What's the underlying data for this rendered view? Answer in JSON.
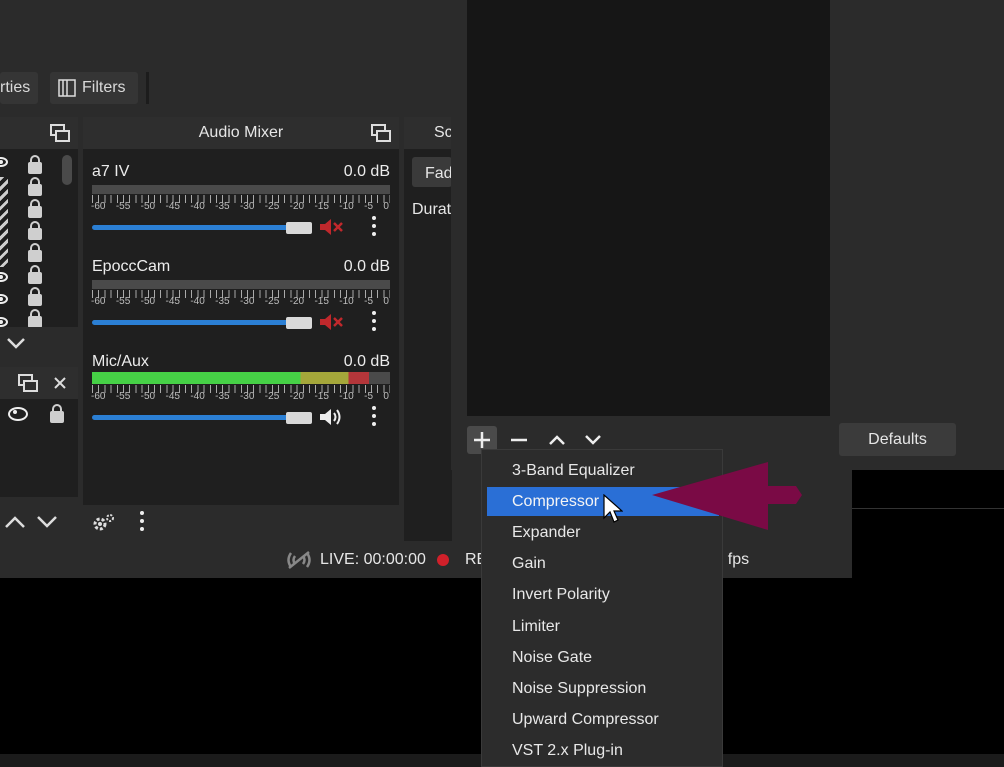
{
  "toolbar": {
    "properties_label": "rties",
    "filters_label": "Filters"
  },
  "mixer": {
    "title": "Audio Mixer",
    "tick_labels": [
      "-60",
      "-55",
      "-50",
      "-45",
      "-40",
      "-35",
      "-30",
      "-25",
      "-20",
      "-15",
      "-10",
      "-5",
      "0"
    ],
    "channels": [
      {
        "name": "a7 IV",
        "db": "0.0 dB",
        "muted": true,
        "level": 0
      },
      {
        "name": "EpoccCam",
        "db": "0.0 dB",
        "muted": true,
        "level": 0
      },
      {
        "name": "Mic/Aux",
        "db": "0.0 dB",
        "muted": false,
        "level": 0.93
      }
    ]
  },
  "transitions": {
    "title_partial": "Sc",
    "fade_partial": "Fad",
    "duration_partial": "Durat"
  },
  "filter_window": {
    "defaults_label": "Defaults"
  },
  "status": {
    "live": "LIVE: 00:00:00",
    "rec_partial": "RE",
    "fps_partial": ") fps"
  },
  "menu": {
    "items": [
      "3-Band Equalizer",
      "Compressor",
      "Expander",
      "Gain",
      "Invert Polarity",
      "Limiter",
      "Noise Gate",
      "Noise Suppression",
      "Upward Compressor",
      "VST 2.x Plug-in"
    ],
    "highlighted": "Compressor"
  },
  "colors": {
    "accent": "#2a6fd6",
    "arrow": "#7a0a45",
    "mute_red": "#c0282c",
    "meter_green": "#46d146"
  }
}
